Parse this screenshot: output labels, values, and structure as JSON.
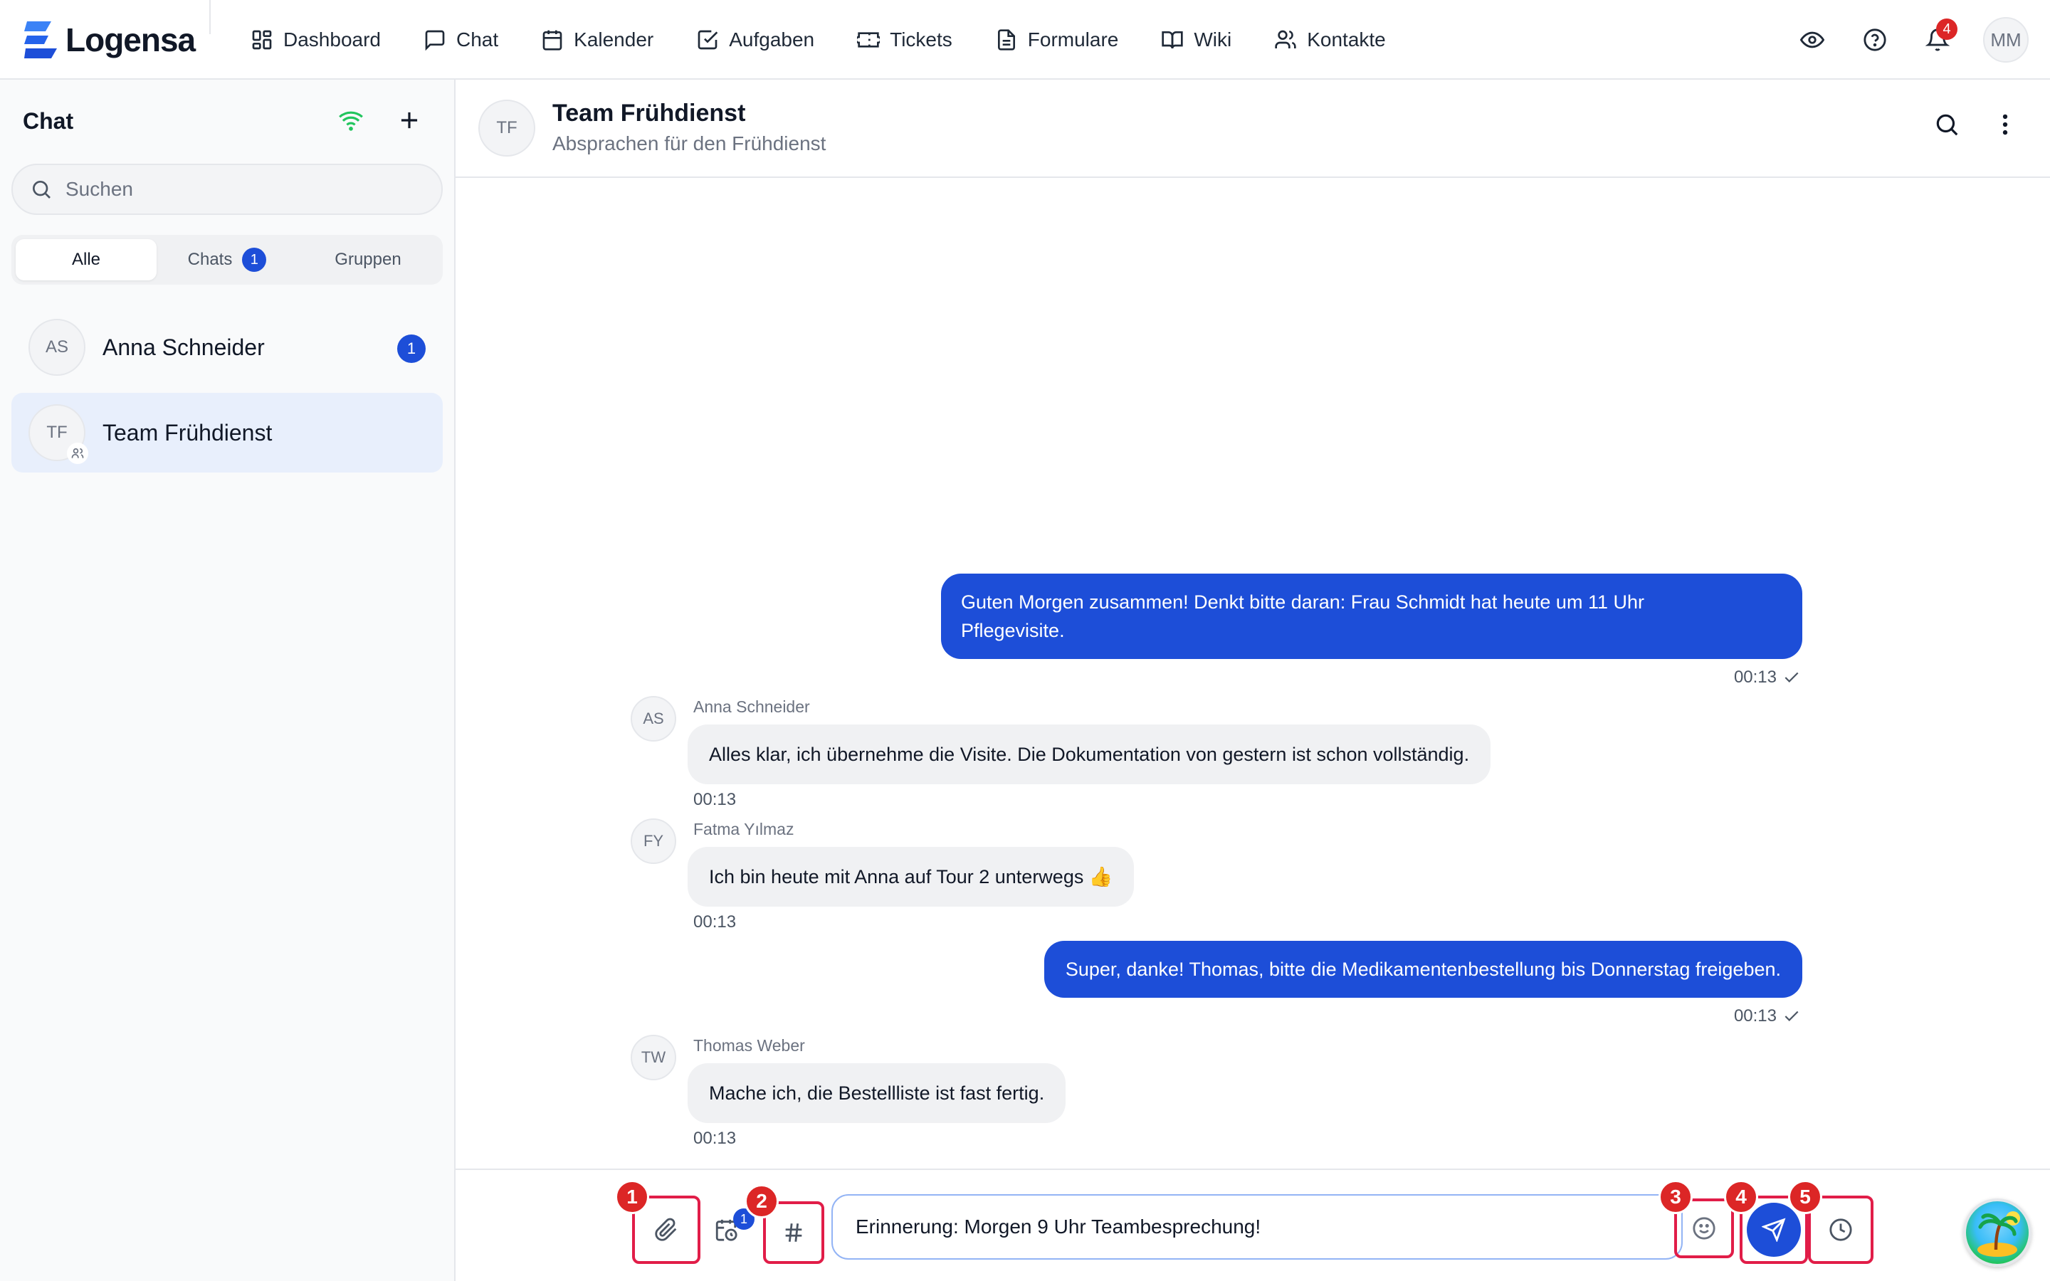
{
  "app": {
    "name": "Logensa"
  },
  "nav": {
    "items": [
      {
        "label": "Dashboard",
        "icon": "dashboard-icon"
      },
      {
        "label": "Chat",
        "icon": "chat-icon"
      },
      {
        "label": "Kalender",
        "icon": "calendar-icon"
      },
      {
        "label": "Aufgaben",
        "icon": "checkbox-icon"
      },
      {
        "label": "Tickets",
        "icon": "ticket-icon"
      },
      {
        "label": "Formulare",
        "icon": "document-icon"
      },
      {
        "label": "Wiki",
        "icon": "book-icon"
      },
      {
        "label": "Kontakte",
        "icon": "contacts-icon"
      }
    ],
    "notifications_count": "4",
    "user_initials": "MM"
  },
  "sidebar": {
    "title": "Chat",
    "search_placeholder": "Suchen",
    "filters": [
      {
        "label": "Alle",
        "active": true
      },
      {
        "label": "Chats",
        "count": "1"
      },
      {
        "label": "Gruppen"
      }
    ],
    "chats": [
      {
        "initials": "AS",
        "name": "Anna Schneider",
        "unread": "1"
      },
      {
        "initials": "TF",
        "name": "Team Frühdienst",
        "group": true,
        "selected": true
      }
    ]
  },
  "conversation": {
    "initials": "TF",
    "title": "Team Frühdienst",
    "subtitle": "Absprachen für den Frühdienst",
    "messages": [
      {
        "direction": "out",
        "text_line1": "Guten Morgen zusammen! Denkt bitte daran: Frau Schmidt hat heute um 11 Uhr",
        "text_line2": "Pflegevisite.",
        "time": "00:13",
        "status": "sent"
      },
      {
        "direction": "in",
        "initials": "AS",
        "sender": "Anna Schneider",
        "text": "Alles klar, ich übernehme die Visite. Die Dokumentation von gestern ist schon vollständig.",
        "time": "00:13"
      },
      {
        "direction": "in",
        "initials": "FY",
        "sender": "Fatma Yılmaz",
        "text": "Ich bin heute mit Anna auf Tour 2 unterwegs 👍",
        "time": "00:13"
      },
      {
        "direction": "out",
        "text": "Super, danke! Thomas, bitte die Medikamentenbestellung bis Donnerstag freigeben.",
        "time": "00:13",
        "status": "sent"
      },
      {
        "direction": "in",
        "initials": "TW",
        "sender": "Thomas Weber",
        "text": "Mache ich, die Bestellliste ist fast fertig.",
        "time": "00:13"
      }
    ]
  },
  "composer": {
    "value": "Erinnerung: Morgen 9 Uhr Teambesprechung!",
    "scheduled_count": "1",
    "markers": [
      "1",
      "2",
      "3",
      "4",
      "5"
    ]
  },
  "colors": {
    "primary": "#1d4ed8",
    "marker": "#dc2626",
    "online": "#22c55e"
  }
}
